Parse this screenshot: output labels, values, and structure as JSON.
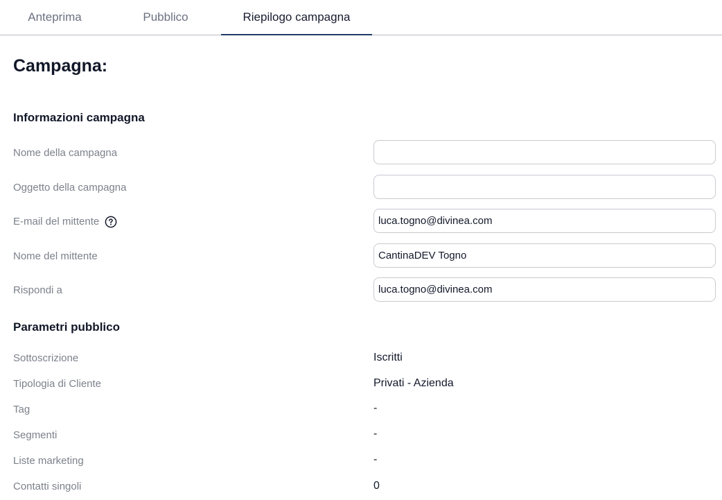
{
  "tabs": [
    {
      "label": "Anteprima",
      "active": false
    },
    {
      "label": "Pubblico",
      "active": false
    },
    {
      "label": "Riepilogo campagna",
      "active": true
    }
  ],
  "page_title": "Campagna:",
  "campaign_info": {
    "title": "Informazioni campagna",
    "fields": [
      {
        "label": "Nome della campagna",
        "value": ""
      },
      {
        "label": "Oggetto della campagna",
        "value": ""
      },
      {
        "label": "E-mail del mittente",
        "value": "luca.togno@divinea.com",
        "icon": "question-circle-icon"
      },
      {
        "label": "Nome del mittente",
        "value": "CantinaDEV Togno"
      },
      {
        "label": "Rispondi a",
        "value": "luca.togno@divinea.com"
      }
    ]
  },
  "audience_params": {
    "title": "Parametri pubblico",
    "rows": [
      {
        "label": "Sottoscrizione",
        "value": "Iscritti"
      },
      {
        "label": "Tipologia di Cliente",
        "value": "Privati - Azienda"
      },
      {
        "label": "Tag",
        "value": "-"
      },
      {
        "label": "Segmenti",
        "value": "-"
      },
      {
        "label": "Liste marketing",
        "value": "-"
      },
      {
        "label": "Contatti singoli",
        "value": "0"
      }
    ]
  },
  "colors": {
    "active_tab_underline": "#1f3a68",
    "label_text": "#7c818b",
    "input_border": "#c7cad0"
  }
}
